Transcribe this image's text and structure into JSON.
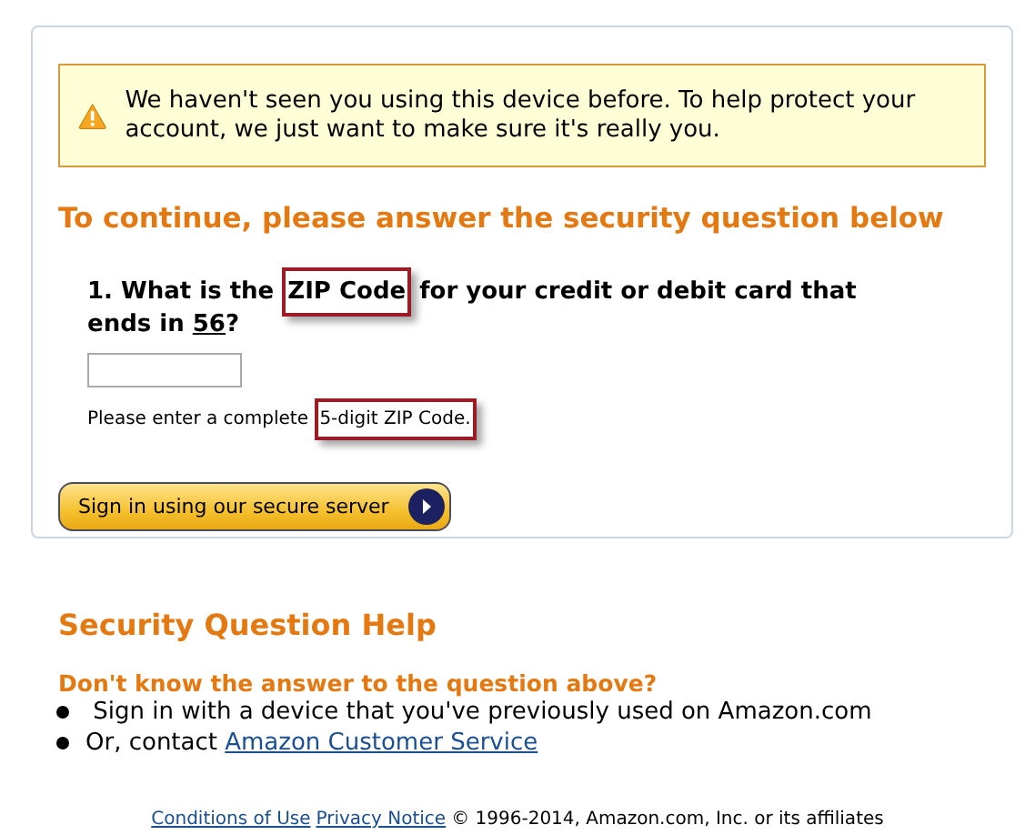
{
  "alert": {
    "message": "We haven't seen you using this device before. To help protect your account, we just want to make sure it's really you."
  },
  "heading": "To continue, please answer the security question below",
  "question": {
    "parts": [
      {
        "text": "1. What is the ",
        "kind": "plain"
      },
      {
        "text": "ZIP Code",
        "kind": "highlight"
      },
      {
        "text": " for your credit or debit card that ends in ",
        "kind": "plain"
      },
      {
        "text": "56",
        "kind": "underline"
      },
      {
        "text": "?",
        "kind": "plain"
      }
    ]
  },
  "hint": {
    "parts": [
      {
        "text": "Please enter a complete ",
        "kind": "plain"
      },
      {
        "text": "5-digit ZIP Code.",
        "kind": "highlight"
      }
    ]
  },
  "sign_in_button": "Sign in using our secure server",
  "help": {
    "title": "Security Question Help",
    "subtitle": "Don't know the answer to the question above?",
    "items": [
      {
        "text": " Sign in with a device that you've previously used on Amazon.com"
      },
      {
        "text": "Or, contact ",
        "link": "Amazon Customer Service"
      }
    ]
  },
  "footer": {
    "links": [
      "Conditions of Use",
      "Privacy Notice"
    ],
    "text": "© 1996-2014, Amazon.com, Inc. or its affiliates"
  }
}
